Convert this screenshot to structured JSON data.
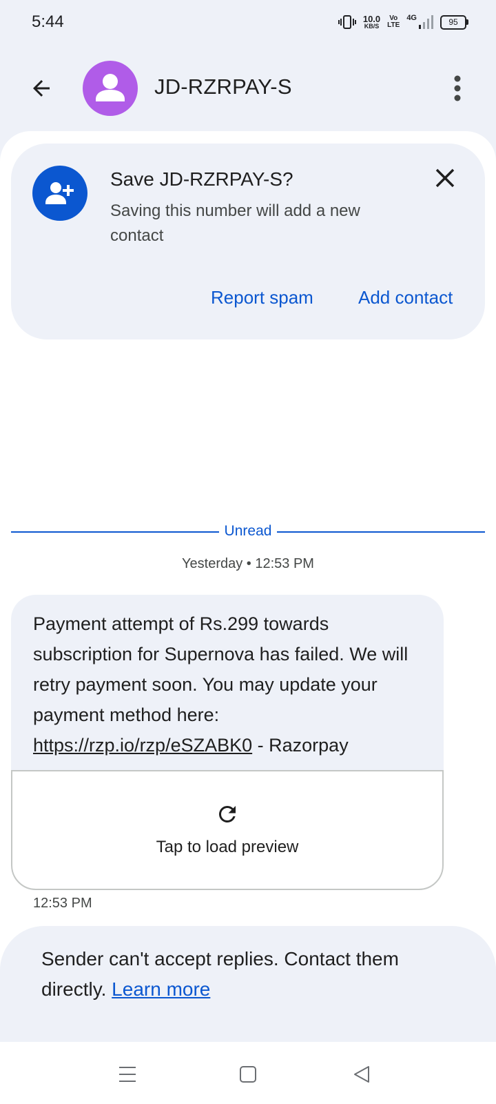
{
  "status_bar": {
    "time": "5:44",
    "net_speed_value": "10.0",
    "net_speed_unit": "KB/S",
    "volte_top": "Vo",
    "volte_bottom": "LTE",
    "network": "4G",
    "battery": "95"
  },
  "header": {
    "contact_name": "JD-RZRPAY-S",
    "avatar_color": "#b05ce8"
  },
  "save_card": {
    "title": "Save JD-RZRPAY-S?",
    "description": "Saving this number will add a new contact",
    "report_spam_label": "Report spam",
    "add_contact_label": "Add contact"
  },
  "conversation": {
    "unread_label": "Unread",
    "date_stamp": "Yesterday • 12:53 PM",
    "message": {
      "text": "Payment attempt of Rs.299 towards subscription for Supernova has failed. We will retry payment soon. You may update your payment method here: ",
      "link": "https://rzp.io/rzp/eSZABK0",
      "suffix": " - Razorpay",
      "preview_label": "Tap to load preview",
      "time": "12:53 PM"
    }
  },
  "reply_notice": {
    "text": "Sender can't accept replies. Contact them directly. ",
    "learn_more": "Learn more"
  },
  "colors": {
    "accent": "#0b57d0",
    "surface": "#eef1f8"
  },
  "nav_bar": {
    "icons": [
      "menu-icon",
      "home-icon",
      "back-triangle-icon"
    ]
  }
}
